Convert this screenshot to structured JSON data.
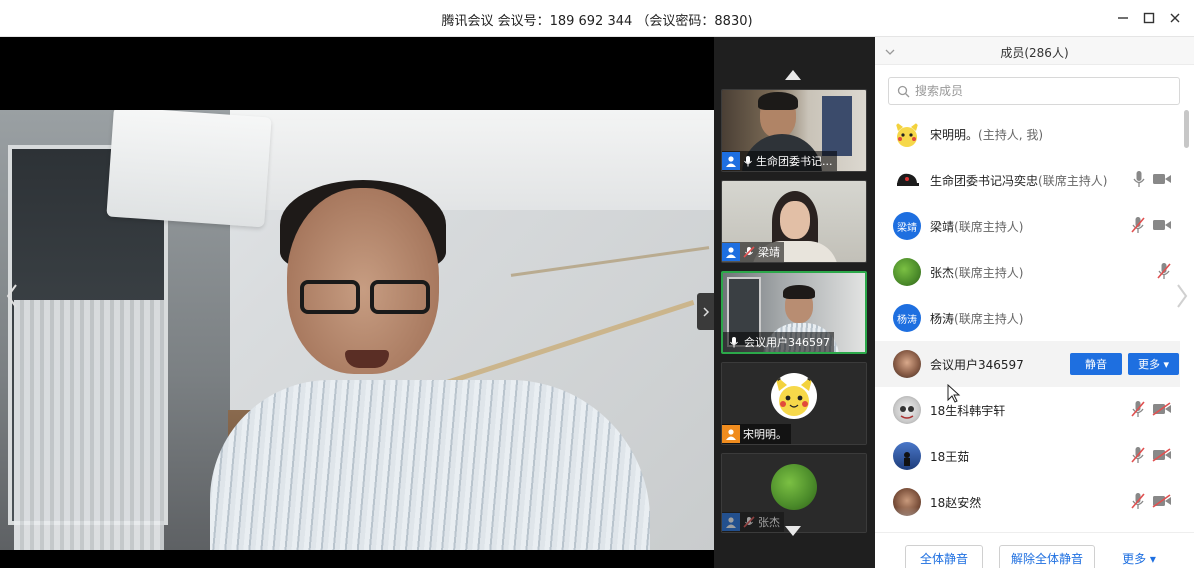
{
  "window": {
    "title": "腾讯会议 会议号：189 692 344 （会议密码：8830)"
  },
  "thumbnails": [
    {
      "label": "生命团委书记...",
      "badge": "host"
    },
    {
      "label": "梁靖",
      "badge": "host"
    },
    {
      "label": "会议用户346597",
      "badge": "none"
    },
    {
      "label": "宋明明。",
      "badge": "me"
    },
    {
      "label": "张杰",
      "badge": "host"
    }
  ],
  "panel": {
    "title": "成员(286人)",
    "search_placeholder": "搜索成员",
    "members": [
      {
        "name": "宋明明。",
        "role": "(主持人, 我)",
        "avatar": "pikachu"
      },
      {
        "name": "生命团委书记冯奕忠",
        "role": "(联席主持人)",
        "avatar": "cap",
        "mic": "on",
        "video": "on"
      },
      {
        "name": "梁靖",
        "role": "(联席主持人)",
        "avatar_text": "梁靖",
        "mic": "muted",
        "video": "on"
      },
      {
        "name": "张杰",
        "role": "(联席主持人)",
        "avatar": "green",
        "mic": "muted"
      },
      {
        "name": "杨涛",
        "role": "(联席主持人)",
        "avatar_text": "杨涛"
      },
      {
        "name": "会议用户346597",
        "role": "",
        "avatar": "photo"
      },
      {
        "name": "18生科韩宇轩",
        "role": "",
        "avatar": "cartoon",
        "mic": "muted",
        "video": "off"
      },
      {
        "name": "18王茹",
        "role": "",
        "avatar": "dark",
        "mic": "muted",
        "video": "off"
      },
      {
        "name": "18赵安然",
        "role": "",
        "avatar": "brown",
        "mic": "muted",
        "video": "off"
      }
    ],
    "row_actions": {
      "mute": "静音",
      "more": "更多 ▾"
    },
    "footer": {
      "mute_all": "全体静音",
      "unmute_all": "解除全体静音",
      "more": "更多 ▾"
    }
  },
  "colors": {
    "accent": "#1e6fe0",
    "active_border": "#2ca84a",
    "muted_red": "#e05050"
  }
}
